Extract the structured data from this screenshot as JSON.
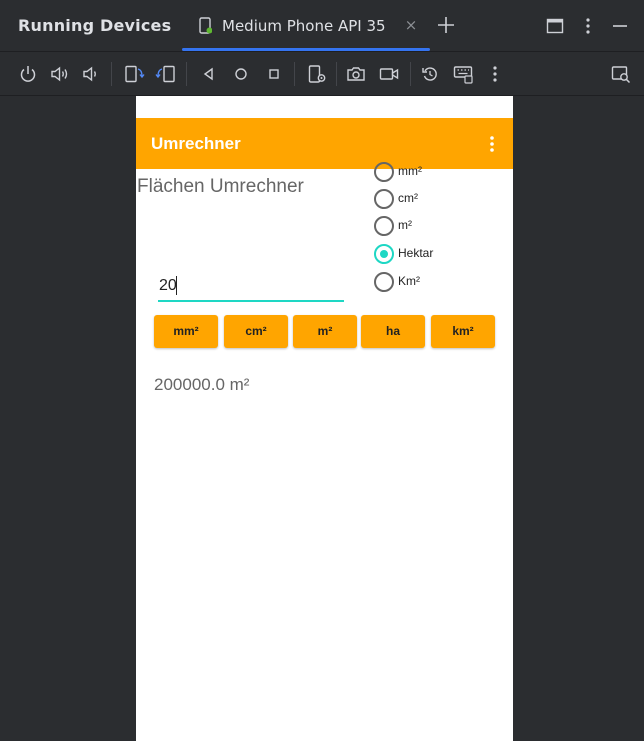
{
  "panel": {
    "title": "Running Devices"
  },
  "tab": {
    "label": "Medium Phone API 35",
    "close_glyph": "×"
  },
  "icons": {
    "tab_device": "phone-running-icon",
    "add": "plus-icon",
    "window": "window-layout-icon",
    "more": "more-vertical-icon",
    "minimize": "minimize-icon",
    "toolbar": [
      "power-icon",
      "volume-up-icon",
      "volume-down-icon",
      "rotate-left-icon",
      "rotate-right-icon",
      "back-icon",
      "home-icon",
      "overview-icon",
      "device-settings-icon",
      "camera-icon",
      "screen-record-icon",
      "reset-icon",
      "keyboard-icon",
      "more-vertical-icon",
      "device-search-icon"
    ]
  },
  "colors": {
    "ide_background": "#2b2d30",
    "accent": "#3574f0",
    "app_bar": "#ffa500",
    "radio_checked": "#1ed7c4",
    "input_underline": "#1ed7c4"
  },
  "app": {
    "title": "Umrechner",
    "heading": "Flächen Umrechner",
    "radio_options": [
      {
        "label": "mm²",
        "checked": false
      },
      {
        "label": "cm²",
        "checked": false
      },
      {
        "label": "m²",
        "checked": false
      },
      {
        "label": "Hektar",
        "checked": true
      },
      {
        "label": "Km²",
        "checked": false
      }
    ],
    "input_value": "20",
    "buttons": [
      "mm²",
      "cm²",
      "m²",
      "ha",
      "km²"
    ],
    "result": "200000.0 m²"
  }
}
